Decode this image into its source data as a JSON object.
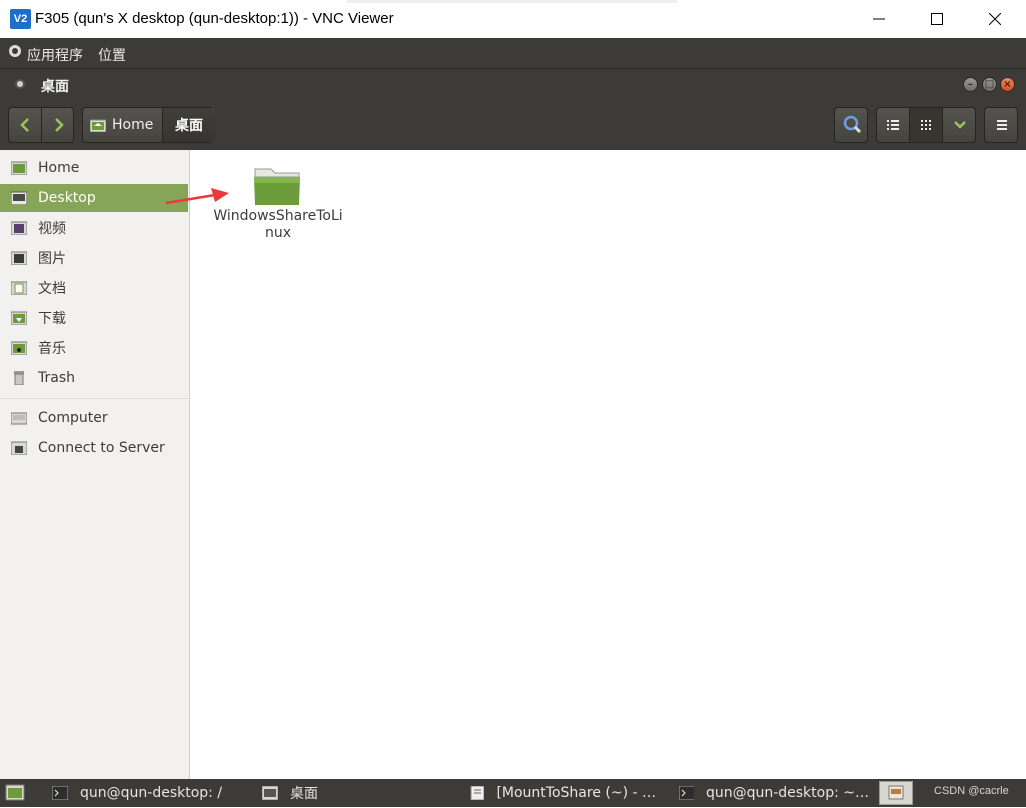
{
  "vnc": {
    "logo": "V2",
    "title": "F305 (qun's X desktop (qun-desktop:1)) - VNC Viewer",
    "min_icon": "minimize-icon",
    "max_icon": "maximize-icon",
    "close_icon": "close-icon"
  },
  "panel": {
    "applications": "应用程序",
    "places": "位置"
  },
  "window": {
    "title": "桌面"
  },
  "toolbar": {
    "breadcrumb": [
      {
        "label": "Home"
      },
      {
        "label": "桌面"
      }
    ]
  },
  "sidebar": {
    "items": [
      {
        "label": "Home",
        "icon": "home-folder-icon"
      },
      {
        "label": "Desktop",
        "icon": "desktop-icon",
        "active": true
      },
      {
        "label": "视频",
        "icon": "video-folder-icon"
      },
      {
        "label": "图片",
        "icon": "pictures-folder-icon"
      },
      {
        "label": "文档",
        "icon": "documents-folder-icon"
      },
      {
        "label": "下载",
        "icon": "downloads-folder-icon"
      },
      {
        "label": "音乐",
        "icon": "music-folder-icon"
      },
      {
        "label": "Trash",
        "icon": "trash-icon"
      },
      {
        "label": "Computer",
        "icon": "computer-icon"
      },
      {
        "label": "Connect to Server",
        "icon": "network-server-icon"
      }
    ]
  },
  "files": [
    {
      "name_line1": "WindowsShareToLi",
      "name_line2": "nux",
      "icon": "folder-icon"
    }
  ],
  "taskbar": {
    "items": [
      {
        "label": "qun@qun-desktop: /",
        "icon": "terminal-icon"
      },
      {
        "label": "桌面",
        "icon": "file-manager-icon"
      },
      {
        "label": "[MountToShare (~) - …",
        "icon": "text-editor-icon"
      },
      {
        "label": "qun@qun-desktop: ~…",
        "icon": "terminal-icon"
      }
    ],
    "watermark": "CSDN @cacrle"
  },
  "colors": {
    "accent": "#87a556",
    "panel": "#3c3b37",
    "close": "#e0531f"
  }
}
